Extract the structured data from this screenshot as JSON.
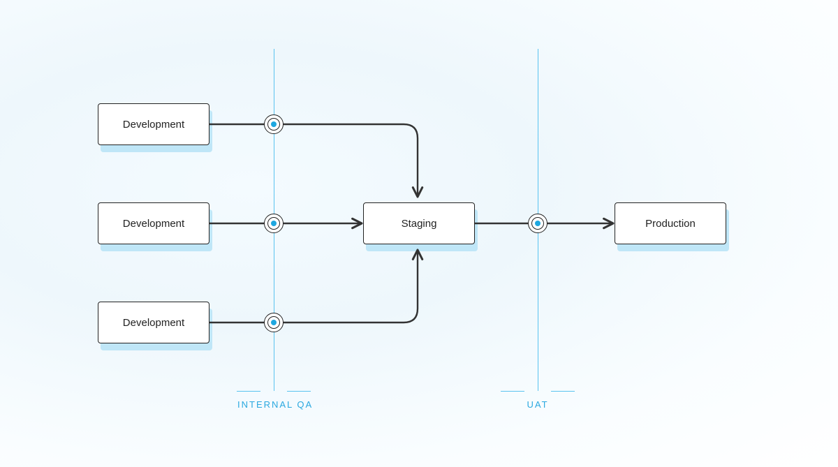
{
  "nodes": {
    "dev1": "Development",
    "dev2": "Development",
    "dev3": "Development",
    "staging": "Staging",
    "production": "Production"
  },
  "lanes": {
    "internal_qa": "INTERNAL QA",
    "uat": "UAT"
  }
}
